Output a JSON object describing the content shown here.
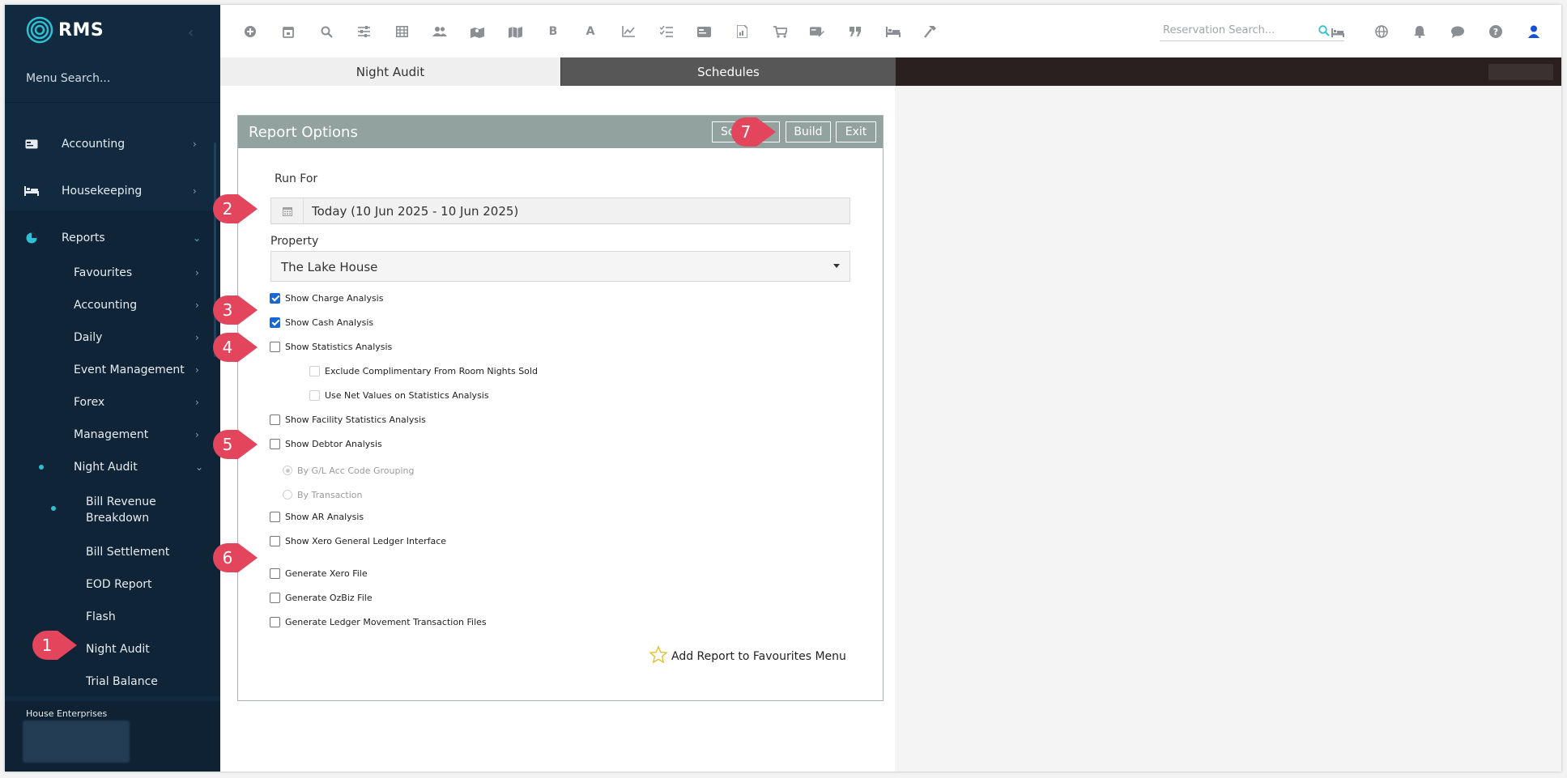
{
  "app": {
    "logo_text": "RMS"
  },
  "sidebar": {
    "menu_search": "Menu Search...",
    "items": [
      {
        "label": "Accounting",
        "icon": "card-icon"
      },
      {
        "label": "Housekeeping",
        "icon": "bed-icon"
      },
      {
        "label": "Reports",
        "icon": "pie-chart-icon"
      }
    ],
    "report_items": [
      "Favourites",
      "Accounting",
      "Daily",
      "Event Management",
      "Forex",
      "Management",
      "Night Audit"
    ],
    "night_audit_items": [
      "Bill Revenue Breakdown",
      "Bill Settlement",
      "EOD Report",
      "Flash",
      "Night Audit",
      "Trial Balance"
    ],
    "footer_name": "House Enterprises"
  },
  "toolbar": {
    "reservation_search_placeholder": "Reservation Search...",
    "icons": [
      "add-circle-icon",
      "calendar-icon",
      "search-icon",
      "sliders-icon",
      "grid-icon",
      "users-icon",
      "map-pin-icon",
      "map-icon",
      "bold-b-icon",
      "font-a-icon",
      "line-chart-icon",
      "checklist-icon",
      "id-card-icon",
      "report-doc-icon",
      "cart-icon",
      "pay-icon",
      "quote-icon",
      "bed-icon",
      "hammer-icon"
    ],
    "right_icons": [
      "globe-icon",
      "bell-icon",
      "chat-icon",
      "help-icon",
      "user-icon"
    ]
  },
  "tabs": [
    {
      "label": "Night Audit",
      "active": true
    },
    {
      "label": "Schedules",
      "active": false
    }
  ],
  "panel": {
    "title": "Report Options",
    "buttons": {
      "schedule": "Sc",
      "build": "Build",
      "exit": "Exit"
    },
    "run_for_label": "Run For",
    "run_for_value": "Today (10 Jun 2025 - 10 Jun 2025)",
    "property_label": "Property",
    "property_value": "The Lake House",
    "options": [
      {
        "label": "Show Charge Analysis",
        "checked": true
      },
      {
        "label": "Show Cash Analysis",
        "checked": true
      },
      {
        "label": "Show Statistics Analysis",
        "checked": false
      },
      {
        "label": "Exclude Complimentary From Room Nights Sold",
        "checked": false
      },
      {
        "label": "Use Net Values on Statistics Analysis",
        "checked": false
      },
      {
        "label": "Show Facility Statistics Analysis",
        "checked": false
      },
      {
        "label": "Show Debtor Analysis",
        "checked": false
      },
      {
        "label": "By G/L Acc Code Grouping",
        "checked": true
      },
      {
        "label": "By Transaction",
        "checked": false
      },
      {
        "label": "Show AR Analysis",
        "checked": false
      },
      {
        "label": "Show Xero General Ledger Interface",
        "checked": false
      },
      {
        "label": "Generate Xero File",
        "checked": false
      },
      {
        "label": "Generate OzBiz File",
        "checked": false
      },
      {
        "label": "Generate Ledger Movement Transaction Files",
        "checked": false
      }
    ],
    "favourites_link": "Add Report to Favourites Menu"
  },
  "callouts": [
    "1",
    "2",
    "3",
    "4",
    "5",
    "6",
    "7"
  ],
  "colors": {
    "sidebar": "#112a3f",
    "accent": "#2dc0d4",
    "callout": "#e2455c",
    "panel_header": "#92a29e",
    "checkbox": "#1668d6"
  }
}
